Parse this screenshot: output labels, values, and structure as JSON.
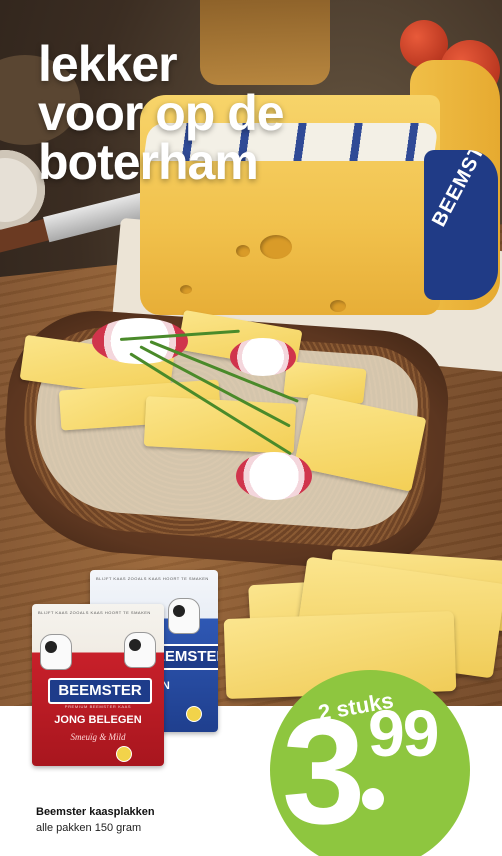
{
  "headline": {
    "line1": "lekker",
    "line2": "voor op de",
    "line3": "boterham"
  },
  "wheel_rind_text": "BEEMSTER",
  "packages": {
    "front": {
      "brand": "BEEMSTER",
      "subline": "PREMIUM BEEMSTER KAAS",
      "variety": "JONG BELEGEN",
      "tagline": "Smeuïg & Mild",
      "topline": "BLIJFT KAAS ZOOALS KAAS HOORT TE SMAKEN"
    },
    "back": {
      "brand": "BEEMSTER",
      "variety": "GEN",
      "topline": "BLIJFT KAAS ZOOALS KAAS HOORT TE SMAKEN"
    }
  },
  "price_badge": {
    "quantity_label": "2 stuks",
    "price_integer": "3",
    "price_cents": "99",
    "color": "#8ec63f"
  },
  "product": {
    "name": "Beemster kaasplakken",
    "description": "alle pakken 150 gram"
  }
}
